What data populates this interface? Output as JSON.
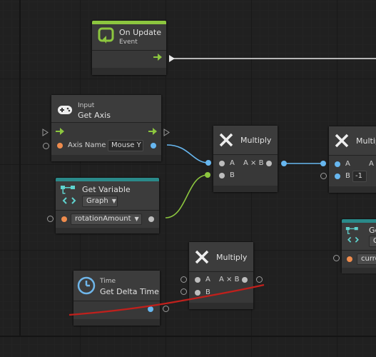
{
  "colors": {
    "background": "#202020",
    "node_body": "#383838",
    "event_accent": "#8cc63f",
    "variable_accent": "#2a8a8a",
    "float_port": "#67b7f0",
    "string_port": "#ef8c4d",
    "object_port": "#8cc63f",
    "flow_wire": "#e8e8e8",
    "annotation_stroke": "#c0201c"
  },
  "nodes": {
    "on_update": {
      "title": "On Update",
      "subtitle": "Event",
      "icon": "update-event-icon"
    },
    "get_axis": {
      "subtitle": "Input",
      "title": "Get Axis",
      "axis_name_label": "Axis Name",
      "axis_name_value": "Mouse Y",
      "icon": "gamepad-icon"
    },
    "get_variable": {
      "title": "Get Variable",
      "scope": "Graph",
      "variable": "rotationAmount",
      "icon": "variable-icon"
    },
    "multiply_1": {
      "title": "Multiply",
      "in_a": "A",
      "in_b": "B",
      "out": "A × B",
      "icon": "multiply-icon"
    },
    "multiply_2": {
      "title": "Multiply",
      "in_a": "A",
      "in_b": "B",
      "out_partial": "A",
      "b_value": "-1",
      "icon": "multiply-icon"
    },
    "multiply_3": {
      "title": "Multiply",
      "in_a": "A",
      "in_b": "B",
      "out": "A × B",
      "icon": "multiply-icon"
    },
    "get_delta_time": {
      "subtitle": "Time",
      "title": "Get Delta Time",
      "icon": "clock-icon"
    },
    "partial_variable": {
      "title": "Ge",
      "scope": "G",
      "variable": "curre",
      "icon": "variable-icon"
    }
  }
}
